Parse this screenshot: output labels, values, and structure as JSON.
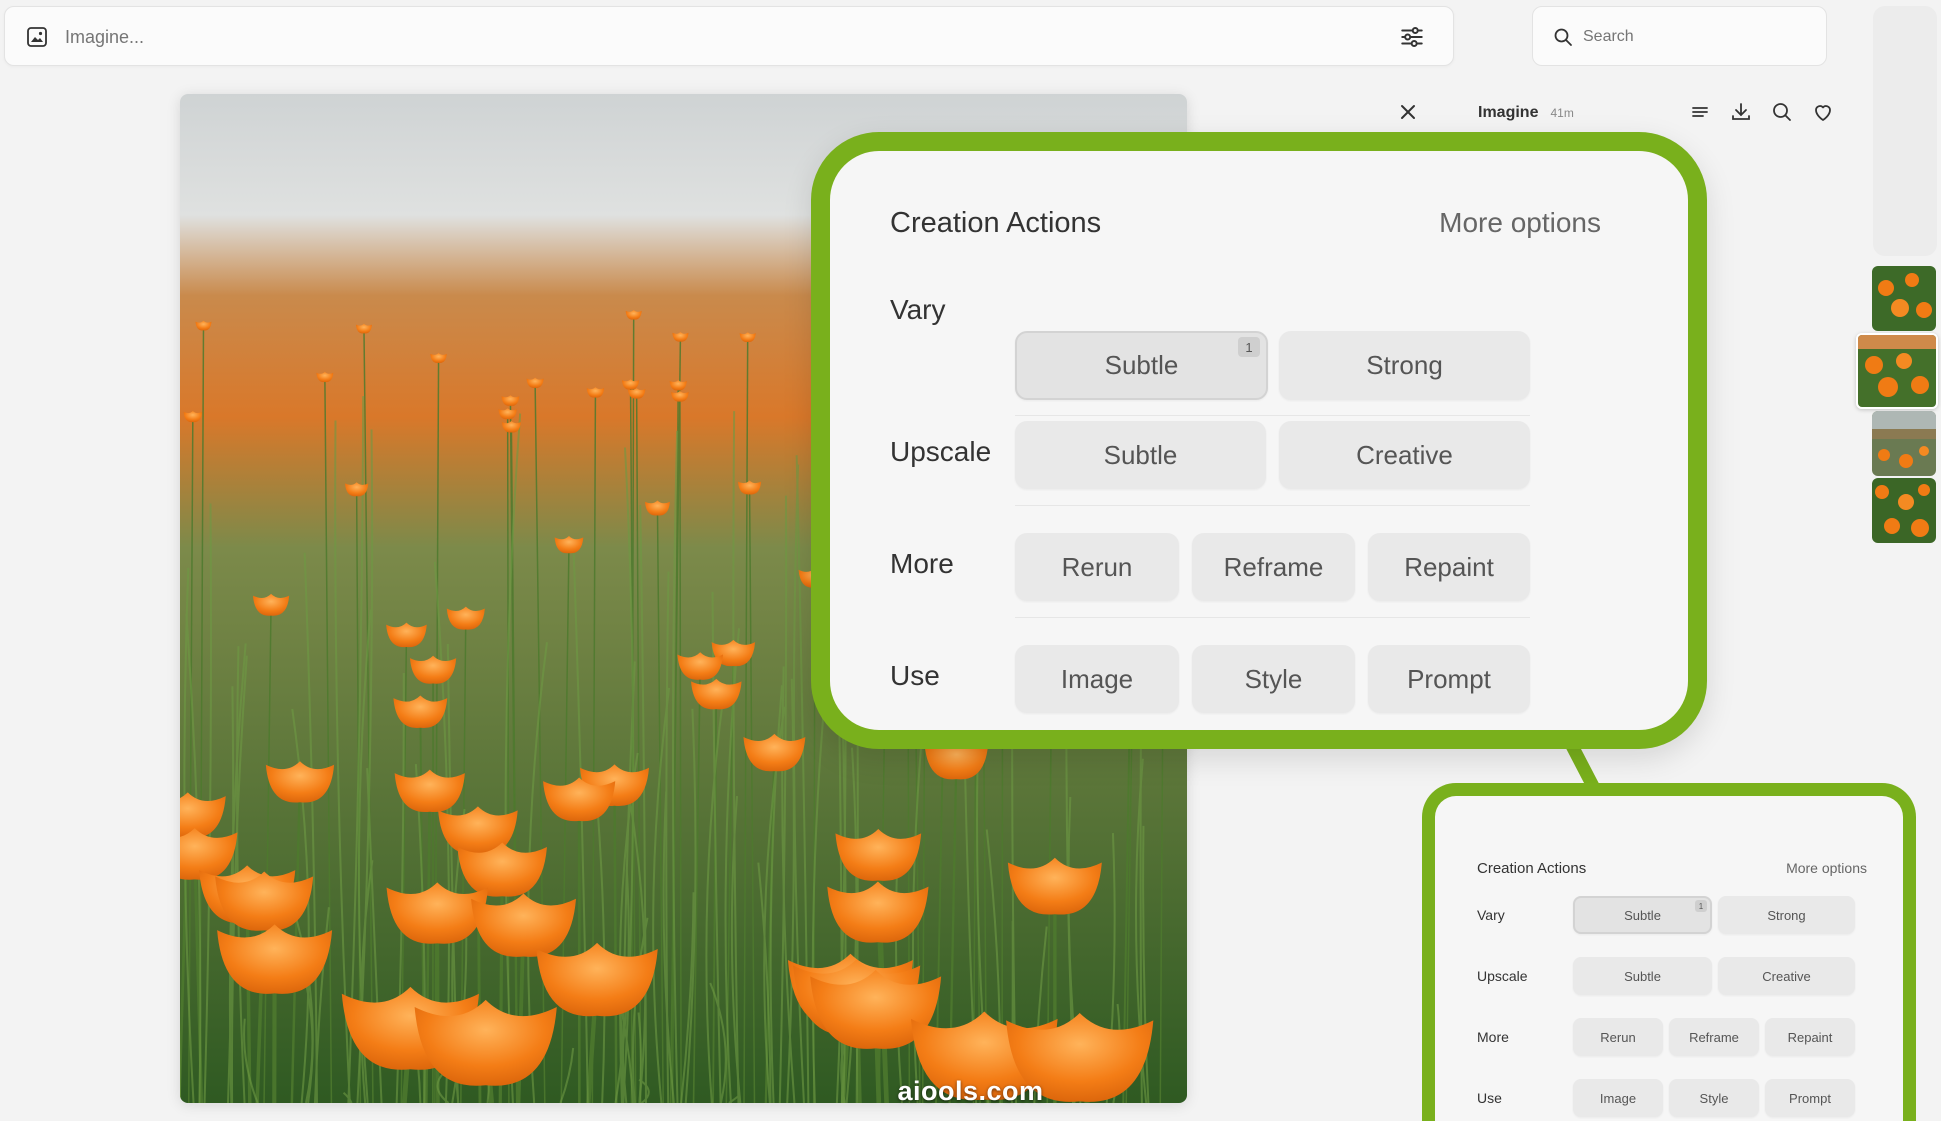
{
  "topbar": {
    "prompt_placeholder": "Imagine...",
    "search_placeholder": "Search"
  },
  "job": {
    "title": "Imagine",
    "time": "41m"
  },
  "watermark": "aiools.com",
  "creation_actions": {
    "title": "Creation Actions",
    "more_options": "More options",
    "rows": [
      {
        "label": "Vary",
        "buttons": [
          "Subtle",
          "Strong"
        ]
      },
      {
        "label": "Upscale",
        "buttons": [
          "Subtle",
          "Creative"
        ]
      },
      {
        "label": "More",
        "buttons": [
          "Rerun",
          "Reframe",
          "Repaint"
        ]
      },
      {
        "label": "Use",
        "buttons": [
          "Image",
          "Style",
          "Prompt"
        ]
      }
    ],
    "selected_badge": "1"
  },
  "colors": {
    "highlight": "#79b01c",
    "poppy": "#f07b14",
    "stem": "#4e7a2e"
  },
  "icons": {
    "prompt": "image-icon",
    "settings": "sliders-icon",
    "search": "search-icon",
    "close": "close-icon",
    "menu": "menu-icon",
    "download": "download-icon",
    "zoom": "search-icon",
    "favorite": "heart-icon"
  }
}
